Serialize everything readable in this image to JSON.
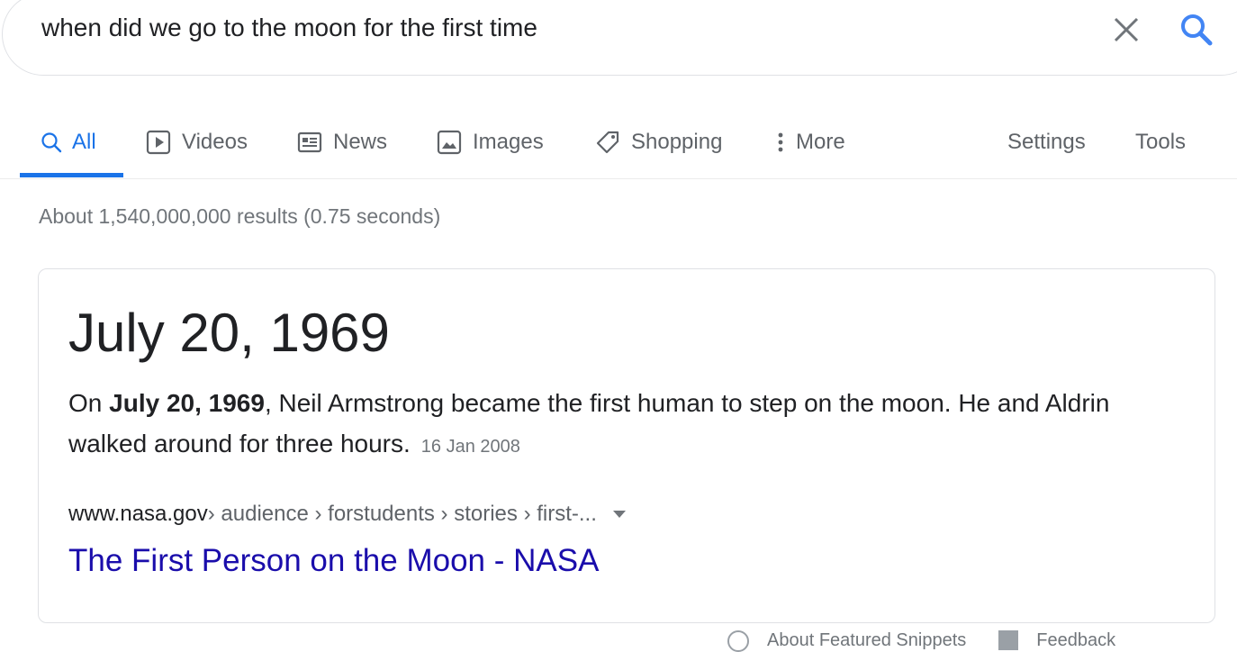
{
  "search": {
    "query": "when did we go to the moon for the first time"
  },
  "tabs": [
    {
      "label": "All",
      "icon": "search-icon",
      "active": true
    },
    {
      "label": "Videos",
      "icon": "play-icon"
    },
    {
      "label": "News",
      "icon": "newspaper-icon"
    },
    {
      "label": "Images",
      "icon": "image-icon"
    },
    {
      "label": "Shopping",
      "icon": "tag-icon"
    },
    {
      "label": "More",
      "icon": "more-vertical-icon"
    }
  ],
  "tools": {
    "settings_label": "Settings",
    "tools_label": "Tools"
  },
  "result_stats": "About 1,540,000,000 results (0.75 seconds)",
  "featured_snippet": {
    "answer": "July 20, 1969",
    "snippet_prefix": "On ",
    "snippet_bold": "July 20, 1969",
    "snippet_rest": ", Neil Armstrong became the first human to step on the moon. He and Aldrin walked around for three hours.",
    "date": "16 Jan 2008",
    "cite_domain": "www.nasa.gov",
    "cite_path": " › audience › forstudents › stories › first-...",
    "title": "The First Person on the Moon - NASA"
  },
  "footer": {
    "about_label": "About Featured Snippets",
    "feedback_label": "Feedback"
  },
  "colors": {
    "accent": "#1a73e8",
    "link": "#1a0dab",
    "text": "#202124",
    "muted": "#70757a"
  }
}
